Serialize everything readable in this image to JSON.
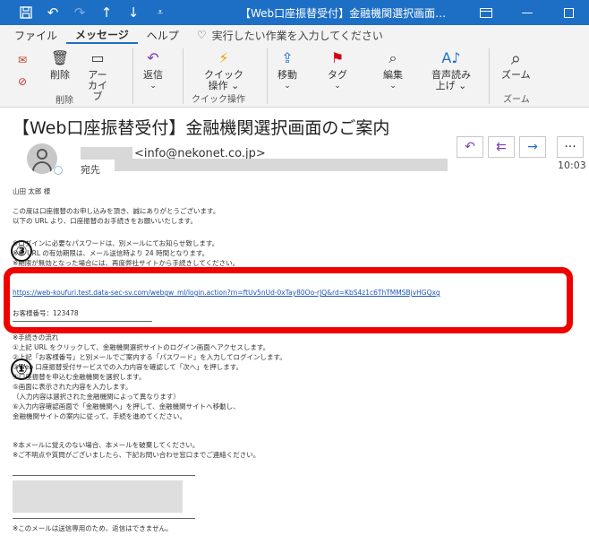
{
  "titlebar": {
    "title": "【Web口座振替受付】金融機関選択画面…",
    "icons": [
      "save-icon",
      "undo-icon",
      "redo-icon",
      "up-arrow-icon",
      "down-arrow-icon",
      "dropdown-icon"
    ]
  },
  "menu": {
    "items": [
      "ファイル",
      "メッセージ",
      "ヘルプ"
    ],
    "search_placeholder": "実行したい作業を入力してください"
  },
  "ribbon": {
    "delete": "削除",
    "archive_1": "アー",
    "archive_2": "カイブ",
    "reply": "返信",
    "quick_1": "クイック",
    "quick_2": "操作 ⌄",
    "move": "移動",
    "tag": "タグ",
    "edit": "編集",
    "read_1": "音声読み",
    "read_2": "上げ ⌄",
    "zoom": "ズーム",
    "group_delete": "削除",
    "group_quick": "クイック操作",
    "group_zoom": "ズーム"
  },
  "message": {
    "subject": "【Web口座振替受付】金融機関選択画面のご案内",
    "sender_email": "<info@nekonet.co.jp>",
    "to_label": "宛先",
    "time": "10:03"
  },
  "body": {
    "greeting": "山田 太郎 様",
    "l1": "この度は口座振替のお申し込みを頂き、誠にありがとうございます。",
    "l2": "以下の URL より、口座振替のお手続きをお願いいたします。",
    "l3": "※ログインに必要なパスワードは、別メールにてお知らせ致します。",
    "l4": "※本 URL の有効期限は、メール送信時より 24 時間となります。",
    "l5": "※期限が無効となった場合には、再度弊社サイトから手続きしてください。",
    "url": "https://web-koufuri.test.data-sec-sv.com/webgw_ml/login.action?rn=ftUv5nUd-0xTay80Oo-rJQ&rd=KbS4z1c6ThTMMSBjvHGQxg",
    "customer_no": "お客様番号：123478",
    "steps_title": "※手続きの流れ",
    "s1": "①上記 URL をクリックして、金融機関選択サイトのログイン画面へアクセスします。",
    "s2": "②上記「お客様番号」と別メールでご案内する「パスワード」を入力してログインします。",
    "s3": "③Web 口座振替受付サービスでの入力内容を確認して「次へ」を押します。",
    "s4": "④口座振替を申込む金融機関を選択します。",
    "s5": "⑤画面に表示された内容を入力します。",
    "s6": "（入力内容は選択された金融機関によって異なります）",
    "s7": "⑥入力内容確認画面で「金融機関へ」を押して、金融機関サイトへ移動し、",
    "s8": "金融機関サイトの案内に従って、手続を進めてください。",
    "n1": "※本メールに覚えのない場合、本メールを破棄してください。",
    "n2": "※ご不明点や質問がございましたら、下記お問い合わせ窓口までご連絡ください。",
    "footer": "※このメールは送信専用のため、返信はできません。"
  },
  "annotations": {
    "three": "③",
    "one": "①"
  },
  "colors": {
    "titlebar": "#1d6fc6",
    "highlight": "#f10000",
    "link": "#1f55b8"
  }
}
